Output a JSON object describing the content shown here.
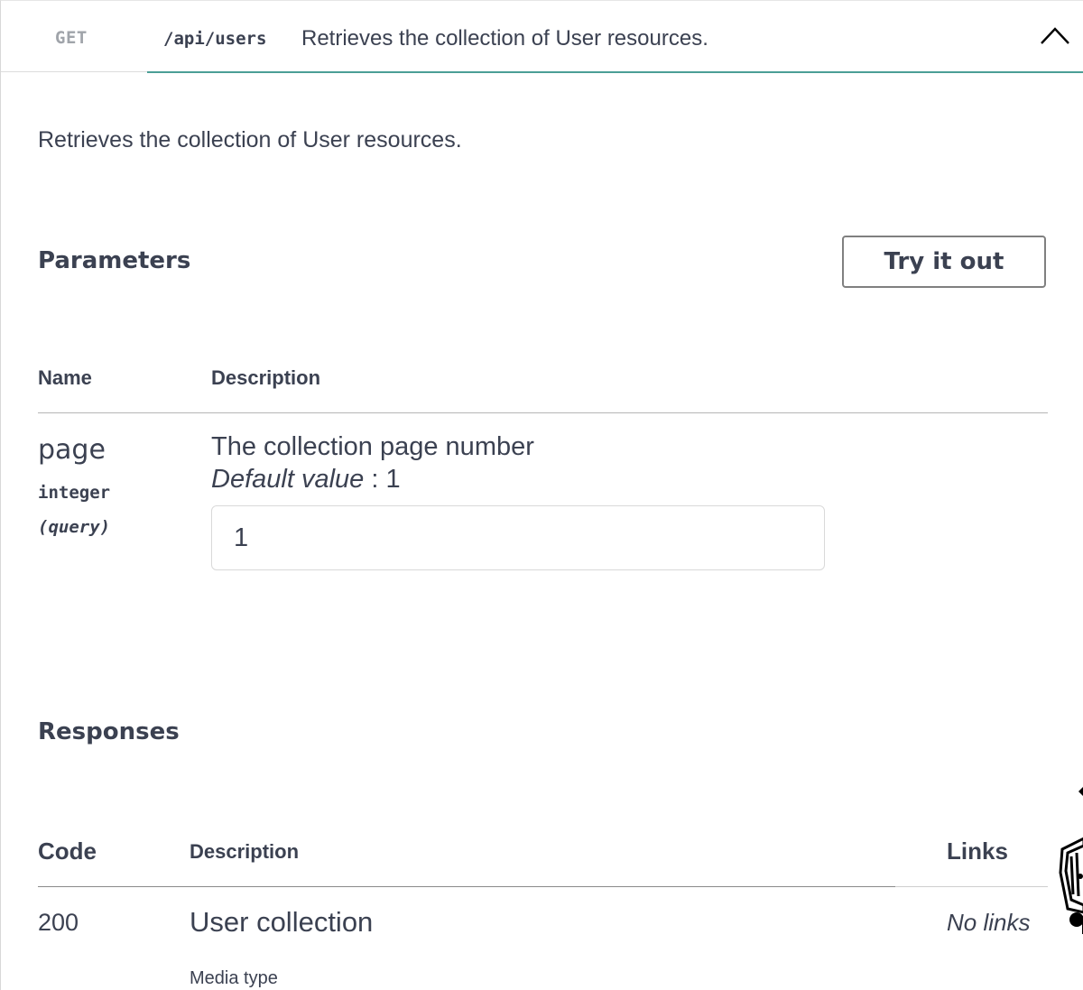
{
  "operation": {
    "method": "GET",
    "path": "/api/users",
    "summary": "Retrieves the collection of User resources.",
    "description": "Retrieves the collection of User resources.",
    "collapse_icon": "chevron-up-icon"
  },
  "parameters": {
    "title": "Parameters",
    "try_label": "Try it out",
    "headers": {
      "name": "Name",
      "description": "Description"
    },
    "items": [
      {
        "name": "page",
        "type": "integer",
        "in": "(query)",
        "description": "The collection page number",
        "default_label": "Default value",
        "default_sep": " : 1",
        "value": "1"
      }
    ]
  },
  "responses": {
    "title": "Responses",
    "headers": {
      "code": "Code",
      "description": "Description",
      "links": "Links"
    },
    "items": [
      {
        "code": "200",
        "description": "User collection",
        "links": "No links",
        "media_type_label": "Media type"
      }
    ]
  },
  "colors": {
    "accent_line": "#4b9e96",
    "text": "#3b4151",
    "method_text": "#a0a4aa"
  }
}
